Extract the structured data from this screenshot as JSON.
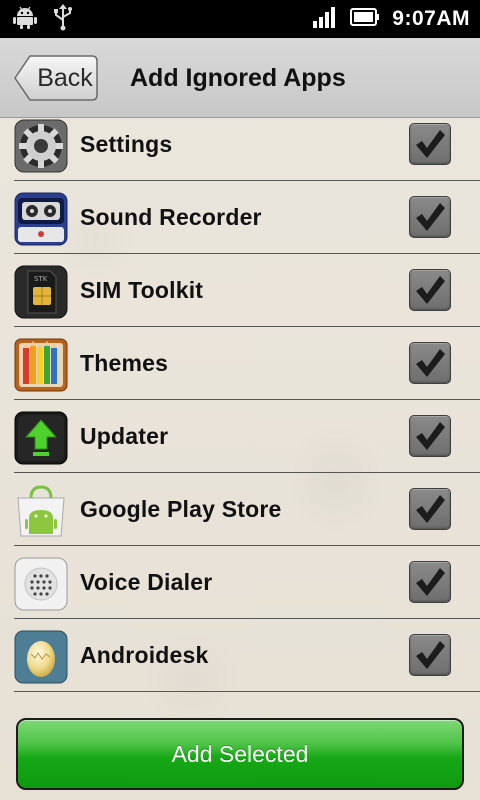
{
  "status_bar": {
    "time": "9:07AM",
    "icons": [
      "android-icon",
      "usb-icon",
      "signal-icon",
      "battery-icon"
    ]
  },
  "title_bar": {
    "back_label": "Back",
    "title": "Add Ignored Apps"
  },
  "apps": [
    {
      "name": "Settings",
      "icon": "settings-gear-icon",
      "checked": true
    },
    {
      "name": "Sound Recorder",
      "icon": "sound-recorder-icon",
      "checked": true
    },
    {
      "name": "SIM Toolkit",
      "icon": "sim-card-icon",
      "checked": true
    },
    {
      "name": "Themes",
      "icon": "themes-pencils-icon",
      "checked": true
    },
    {
      "name": "Updater",
      "icon": "updater-arrow-icon",
      "checked": true
    },
    {
      "name": "Google Play Store",
      "icon": "play-store-icon",
      "checked": true
    },
    {
      "name": "Voice Dialer",
      "icon": "voice-dialer-icon",
      "checked": true
    },
    {
      "name": "Androidesk",
      "icon": "androidesk-egg-icon",
      "checked": true
    }
  ],
  "footer": {
    "add_selected_label": "Add Selected"
  },
  "colors": {
    "accent_green": "#17a817",
    "background": "#ebe6dc",
    "status_bar": "#000000"
  }
}
